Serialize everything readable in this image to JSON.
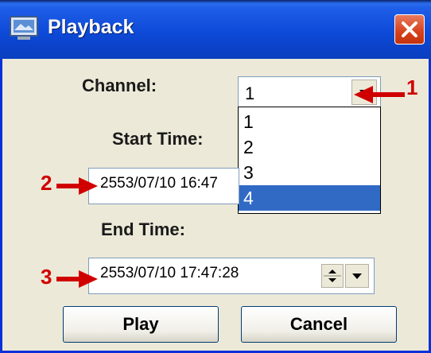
{
  "window": {
    "title": "Playback"
  },
  "channel": {
    "label": "Channel:",
    "selected": "1",
    "options": [
      "1",
      "2",
      "3",
      "4"
    ],
    "highlighted": "4"
  },
  "start_time": {
    "label": "Start Time:",
    "value": "2553/07/10 16:47"
  },
  "end_time": {
    "label": "End Time:",
    "value": "2553/07/10 17:47:28"
  },
  "buttons": {
    "play": "Play",
    "cancel": "Cancel"
  },
  "annotations": [
    "1",
    "2",
    "3"
  ],
  "colors": {
    "annotation_red": "#d10000",
    "title_blue": "#0d4ad8",
    "highlight": "#316ac5"
  }
}
